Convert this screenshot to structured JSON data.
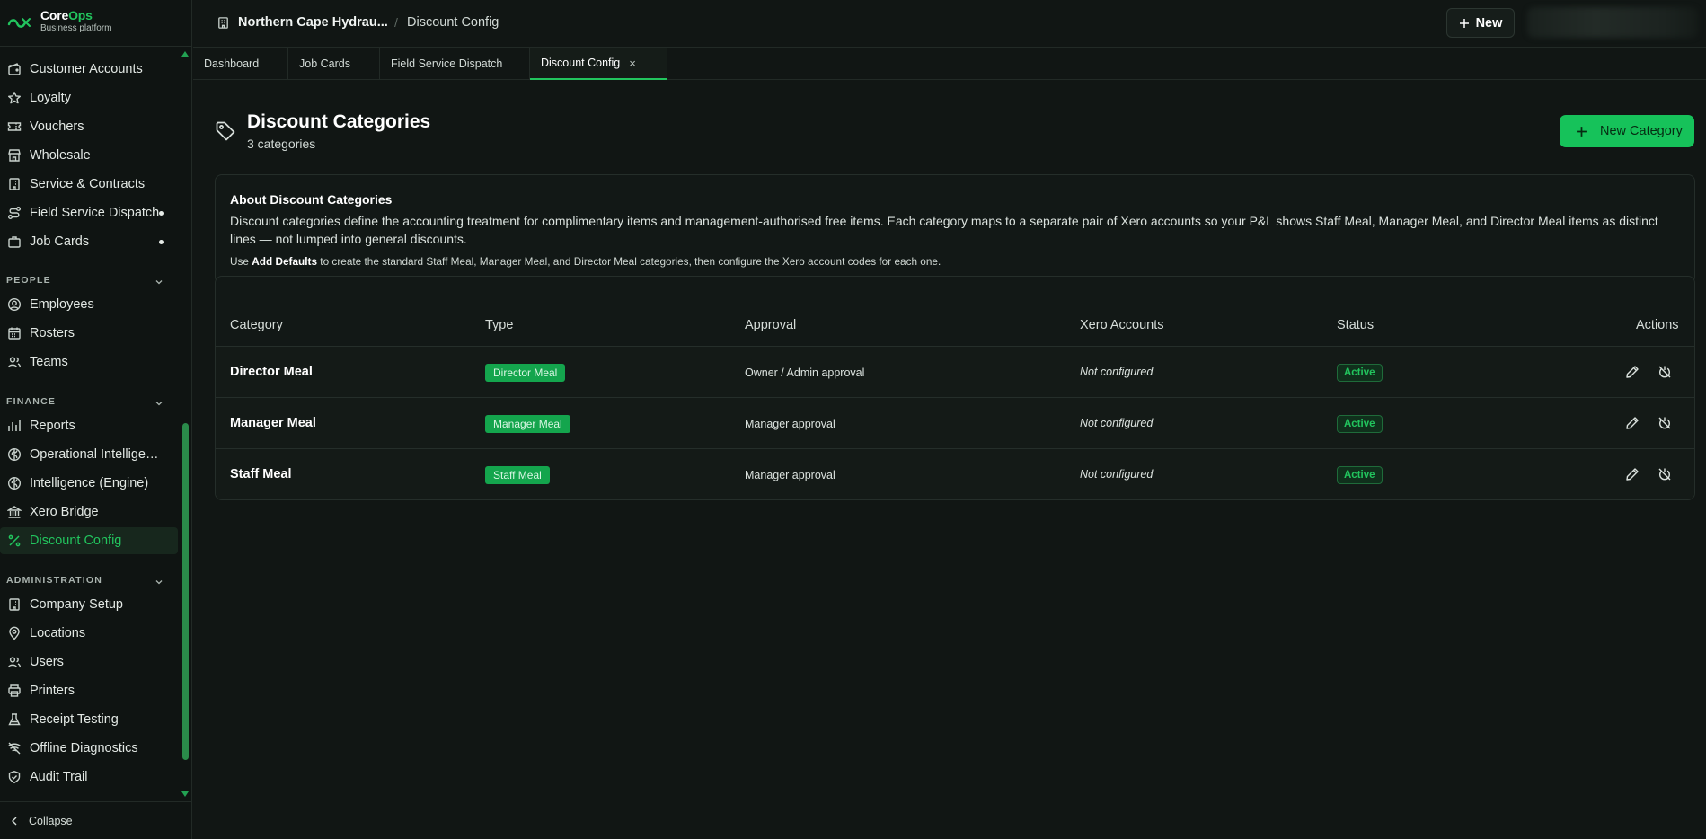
{
  "brand": {
    "name_part1": "Core",
    "name_part2": "Ops",
    "subtitle": "Business platform"
  },
  "sidebar": {
    "groups": [
      {
        "label": "",
        "items": [
          {
            "label": "Customer Accounts",
            "icon": "wallet-icon"
          },
          {
            "label": "Loyalty",
            "icon": "star-icon"
          },
          {
            "label": "Vouchers",
            "icon": "ticket-icon"
          },
          {
            "label": "Wholesale",
            "icon": "store-icon"
          },
          {
            "label": "Service & Contracts",
            "icon": "building-icon"
          },
          {
            "label": "Field Service Dispatch",
            "icon": "route-icon",
            "dot": true
          },
          {
            "label": "Job Cards",
            "icon": "briefcase-icon",
            "dot": true
          }
        ]
      },
      {
        "label": "PEOPLE",
        "items": [
          {
            "label": "Employees",
            "icon": "user-circle-icon"
          },
          {
            "label": "Rosters",
            "icon": "calendar-icon"
          },
          {
            "label": "Teams",
            "icon": "users-icon"
          }
        ]
      },
      {
        "label": "FINANCE",
        "items": [
          {
            "label": "Reports",
            "icon": "bar-chart-icon"
          },
          {
            "label": "Operational Intelligence",
            "icon": "brain-icon"
          },
          {
            "label": "Intelligence (Engine)",
            "icon": "brain-icon"
          },
          {
            "label": "Xero Bridge",
            "icon": "bank-icon"
          },
          {
            "label": "Discount Config",
            "icon": "percent-icon",
            "active": true
          }
        ]
      },
      {
        "label": "ADMINISTRATION",
        "items": [
          {
            "label": "Company Setup",
            "icon": "building-icon"
          },
          {
            "label": "Locations",
            "icon": "map-pin-icon"
          },
          {
            "label": "Users",
            "icon": "users-icon"
          },
          {
            "label": "Printers",
            "icon": "printer-icon"
          },
          {
            "label": "Receipt Testing",
            "icon": "flask-icon"
          },
          {
            "label": "Offline Diagnostics",
            "icon": "wifi-off-icon"
          },
          {
            "label": "Audit Trail",
            "icon": "shield-check-icon"
          }
        ]
      }
    ],
    "collapse_label": "Collapse"
  },
  "topbar": {
    "org_name": "Northern Cape Hydrau...",
    "separator": "/",
    "page": "Discount Config",
    "new_button": "New"
  },
  "tabs": [
    {
      "label": "Dashboard"
    },
    {
      "label": "Job Cards"
    },
    {
      "label": "Field Service Dispatch"
    },
    {
      "label": "Discount Config",
      "active": true,
      "close": "×"
    }
  ],
  "page": {
    "title": "Discount Categories",
    "subtitle": "3 categories",
    "primary_button": "New Category"
  },
  "info": {
    "title": "About Discount Categories",
    "body": "Discount categories define the accounting treatment for complimentary items and management-authorised free items. Each category maps to a separate pair of Xero accounts so your P&L shows Staff Meal, Manager Meal, and Director Meal items as distinct lines — not lumped into general discounts.",
    "note_prefix": "Use ",
    "note_bold": "Add Defaults",
    "note_suffix": " to create the standard Staff Meal, Manager Meal, and Director Meal categories, then configure the Xero account codes for each one."
  },
  "table": {
    "columns": [
      "Category",
      "Type",
      "Approval",
      "Xero Accounts",
      "Status",
      "Actions"
    ],
    "rows": [
      {
        "category": "Director Meal",
        "type": "Director Meal",
        "approval": "Owner / Admin approval",
        "xero": "Not configured",
        "status": "Active"
      },
      {
        "category": "Manager Meal",
        "type": "Manager Meal",
        "approval": "Manager approval",
        "xero": "Not configured",
        "status": "Active"
      },
      {
        "category": "Staff Meal",
        "type": "Staff Meal",
        "approval": "Manager approval",
        "xero": "Not configured",
        "status": "Active"
      }
    ]
  },
  "colors": {
    "accent": "#22c55e",
    "background": "#111614",
    "badge": "#14a54d"
  }
}
